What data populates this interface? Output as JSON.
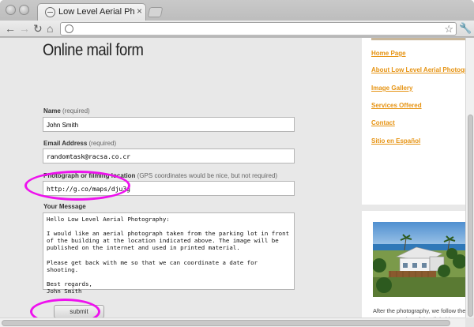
{
  "browser": {
    "tab_title": "Low Level Aerial Photograph",
    "tab_close": "×",
    "back_glyph": "←",
    "forward_glyph": "→",
    "reload_glyph": "↻",
    "home_glyph": "⌂",
    "star_glyph": "☆",
    "wrench_glyph": "🔧",
    "address_value": ""
  },
  "form": {
    "title": "Online mail form",
    "name_label": "Name",
    "name_req": " (required)",
    "name_value": "John Smith",
    "email_label": "Email Address",
    "email_req": " (required)",
    "email_value": "randomtask@racsa.co.cr",
    "location_label": "Photograph or filming location",
    "location_note": " (GPS coordinates would be nice, but not required)",
    "location_value": "http://g.co/maps/dju3g",
    "message_label": "Your Message",
    "message_value": "Hello Low Level Aerial Photography:\n\nI would like an aerial photograph taken from the parking lot in front of the building at the location indicated above. The image will be published on the internet and used in printed material.\n\nPlease get back with me so that we can coordinate a date for shooting.\n\nBest regards,\nJohn Smith",
    "submit_label": "submit"
  },
  "sidebar": {
    "links": [
      "Home Page",
      "About Low Level Aerial Photogra",
      "Image Gallery",
      "Services Offered",
      "Contact",
      "Sitio en Español"
    ],
    "caption": "After the photography, we follow the with post processing of the digital images to bring out the best of yo project."
  },
  "colors": {
    "link": "#e69312",
    "highlight": "#ee11ee"
  }
}
